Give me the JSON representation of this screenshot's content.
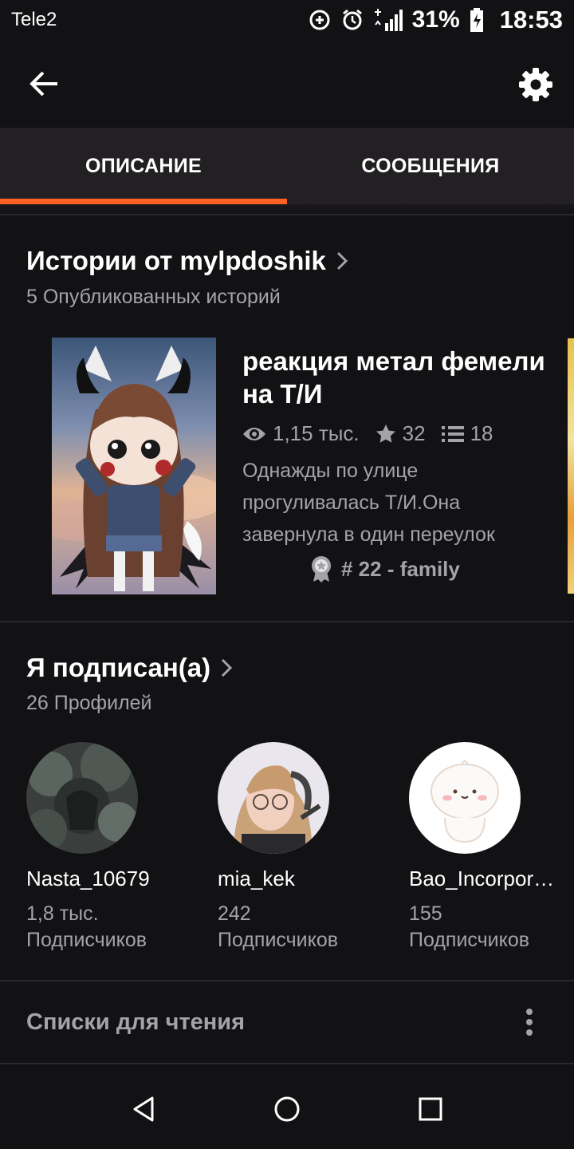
{
  "status": {
    "carrier": "Tele2",
    "battery": "31%",
    "time": "18:53",
    "icons": [
      "data-saver-icon",
      "alarm-icon",
      "signal-icon",
      "battery-charging-icon"
    ]
  },
  "appbar": {
    "back_icon": "back-arrow-icon",
    "settings_icon": "gear-icon"
  },
  "tabs": [
    {
      "label": "ОПИСАНИЕ",
      "active": true
    },
    {
      "label": "СООБЩЕНИЯ",
      "active": false
    }
  ],
  "stories": {
    "title": "Истории от mylpdoshik",
    "subtitle": "5 Опубликованных историй",
    "items": [
      {
        "title": "реакция метал фемели на Т/И",
        "reads": "1,15 тыс.",
        "votes": "32",
        "parts": "18",
        "description": "Однажды по улице прогуливалась Т/И.Она завернула в один переулок",
        "rank": "# 22 - family"
      }
    ]
  },
  "following": {
    "title": "Я подписан(а)",
    "subtitle": "26 Профилей",
    "profiles": [
      {
        "name": "Nasta_10679",
        "count": "1,8 тыс.",
        "label": "Подписчиков"
      },
      {
        "name": "mia_kek",
        "count": "242",
        "label": "Подписчиков"
      },
      {
        "name": "Bao_Incorporated",
        "count": "155",
        "label": "Подписчиков"
      }
    ]
  },
  "reading_lists": {
    "label": "Списки для чтения"
  },
  "colors": {
    "accent": "#ff6122",
    "background": "#121113",
    "tab_background": "#222022",
    "secondary_text": "#a5a3a5"
  }
}
